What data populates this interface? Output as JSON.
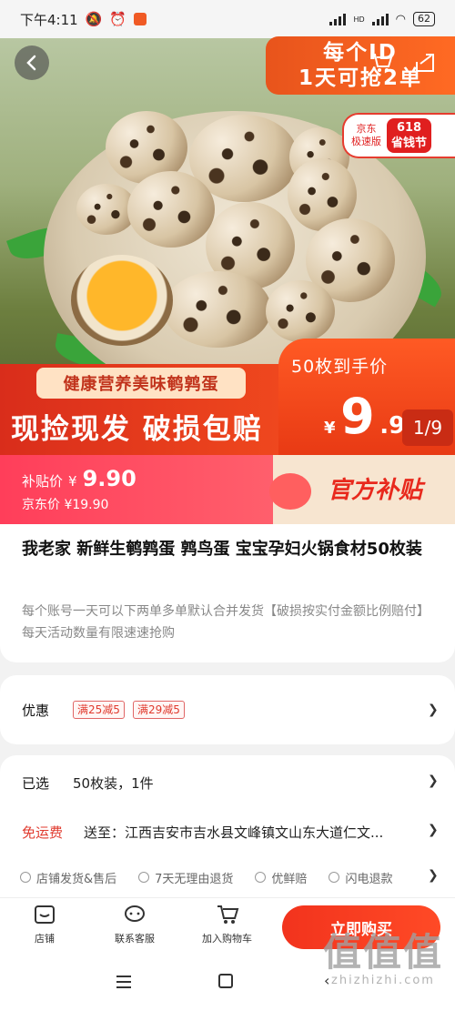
{
  "status_bar": {
    "time": "下午4:11",
    "battery": "62",
    "hd": "HD"
  },
  "hero": {
    "top_promo_line1": "每个ID",
    "top_promo_line2": "1天可抢2单",
    "jd_line1": "京东",
    "jd_line2": "极速版",
    "badge_618": "618",
    "badge_festival": "省钱节",
    "tag": "健康营养美味鹌鹑蛋",
    "slogan": "现捡现发 破损包赔",
    "caption": "50枚到手价",
    "price_yen": "¥",
    "price_int": "9",
    "price_dec": ".9元",
    "unit_price": "1/9"
  },
  "subsidy": {
    "label": "补贴价",
    "price_yen": "¥",
    "price": "9.90",
    "jd_price": "京东价 ¥19.90",
    "official": "官方补贴"
  },
  "product": {
    "title": "我老家 新鲜生鹌鹑蛋 鹑鸟蛋 宝宝孕妇火锅食材50枚装",
    "desc": "每个账号一天可以下两单多单默认合并发货【破损按实付金额比例赔付】每天活动数量有限速速抢购"
  },
  "promo": {
    "label": "优惠",
    "coupons": [
      "满25减5",
      "满29减5"
    ]
  },
  "details": {
    "selected_label": "已选",
    "selected_value": "50枚装，1件",
    "shipping_label": "免运费",
    "address": "送至：江西吉安市吉水县文峰镇文山东大道仁文..."
  },
  "guarantees": [
    "店铺发货&售后",
    "7天无理由退货",
    "优鲜赔",
    "闪电退款"
  ],
  "bottom_bar": {
    "store": "店铺",
    "service": "联系客服",
    "cart": "加入购物车",
    "buy": "立即购买"
  },
  "watermark": {
    "big": "值值值",
    "small": "zhizhizhi.com"
  },
  "colors": {
    "accent": "#f2331d",
    "coupon": "#e03a2e",
    "subsidy": "#ff4a5a"
  }
}
